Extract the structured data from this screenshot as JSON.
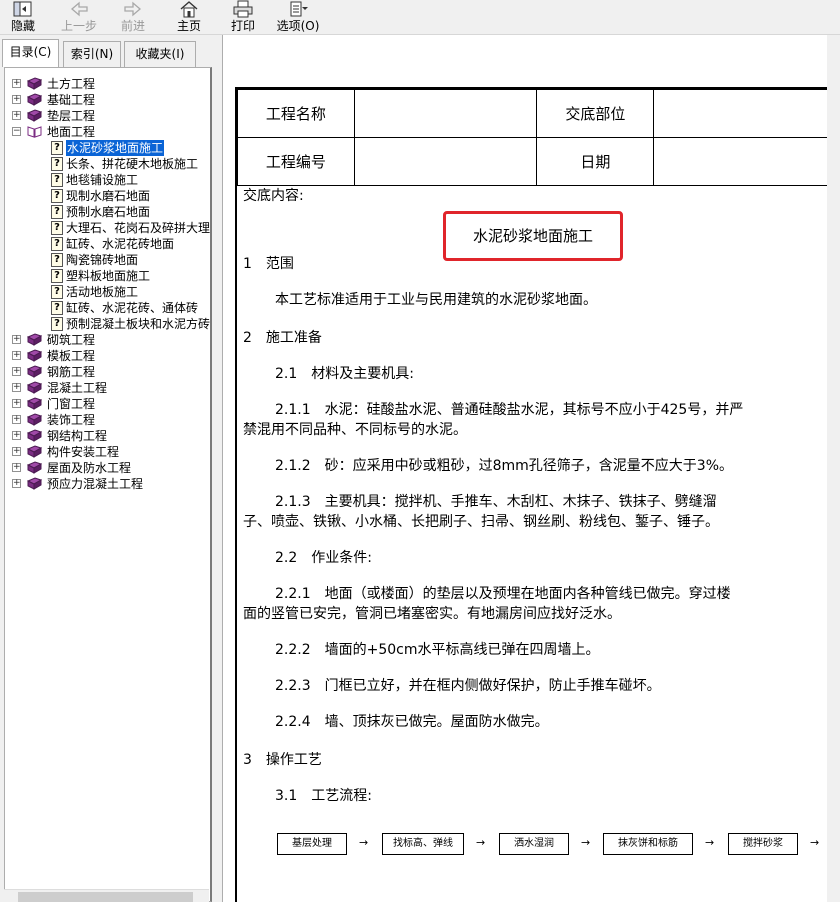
{
  "toolbar": {
    "buttons": [
      {
        "label": "隐藏",
        "enabled": true
      },
      {
        "label": "上一步",
        "enabled": false
      },
      {
        "label": "前进",
        "enabled": false
      },
      {
        "label": "主页",
        "enabled": true
      },
      {
        "label": "打印",
        "enabled": true
      },
      {
        "label": "选项(O)",
        "enabled": true
      }
    ]
  },
  "tabs": [
    "目录(C)",
    "索引(N)",
    "收藏夹(I)"
  ],
  "tree": {
    "top_level_before": [
      "土方工程",
      "基础工程",
      "垫层工程"
    ],
    "open_node": "地面工程",
    "children": [
      "水泥砂浆地面施工",
      "长条、拼花硬木地板施工",
      "地毯铺设施工",
      "现制水磨石地面",
      "预制水磨石地面",
      "大理石、花岗石及碎拼大理",
      "缸砖、水泥花砖地面",
      "陶瓷锦砖地面",
      "塑料板地面施工",
      "活动地板施工",
      "缸砖、水泥花砖、通体砖",
      "预制混凝土板块和水泥方砖"
    ],
    "selected_child": "水泥砂浆地面施工",
    "top_level_after": [
      "砌筑工程",
      "模板工程",
      "钢筋工程",
      "混凝土工程",
      "门窗工程",
      "装饰工程",
      "钢结构工程",
      "构件安装工程",
      "屋面及防水工程",
      "预应力混凝土工程"
    ]
  },
  "document": {
    "header": {
      "project_name_label": "工程名称",
      "location_label": "交底部位",
      "project_no_label": "工程编号",
      "date_label": "日期"
    },
    "content_label": "交底内容:",
    "title": "水泥砂浆地面施工",
    "lines": [
      "1　范围",
      "本工艺标准适用于工业与民用建筑的水泥砂浆地面。",
      "2　施工准备",
      "2.1　材料及主要机具:",
      "2.1.1　水泥：硅酸盐水泥、普通硅酸盐水泥，其标号不应小于425号，并严",
      "禁混用不同品种、不同标号的水泥。",
      "2.1.2　砂：应采用中砂或粗砂，过8mm孔径筛子，含泥量不应大于3%。",
      "2.1.3　主要机具：搅拌机、手推车、木刮杠、木抹子、铁抹子、劈缝溜",
      "子、喷壶、铁锹、小水桶、长把刷子、扫帚、钢丝刷、粉线包、錾子、锤子。",
      "2.2　作业条件:",
      "2.2.1　地面（或楼面）的垫层以及预埋在地面内各种管线已做完。穿过楼",
      "面的竖管已安完，管洞已堵塞密实。有地漏房间应找好泛水。",
      "2.2.2　墙面的+50cm水平标高线已弹在四周墙上。",
      "2.2.3　门框已立好，并在框内侧做好保护，防止手推车碰坏。",
      "2.2.4　墙、顶抹灰已做完。屋面防水做完。",
      "3　操作工艺",
      "3.1　工艺流程:"
    ],
    "flow_steps": [
      "基层处理",
      "找标高、弹线",
      "洒水湿润",
      "抹灰饼和标筋",
      "搅拌砂浆"
    ],
    "flow_arrow": "→"
  },
  "colors": {
    "selection": "#0a64d6",
    "title_box_border": "#e0252b",
    "book_icon": "#7b2c83"
  }
}
